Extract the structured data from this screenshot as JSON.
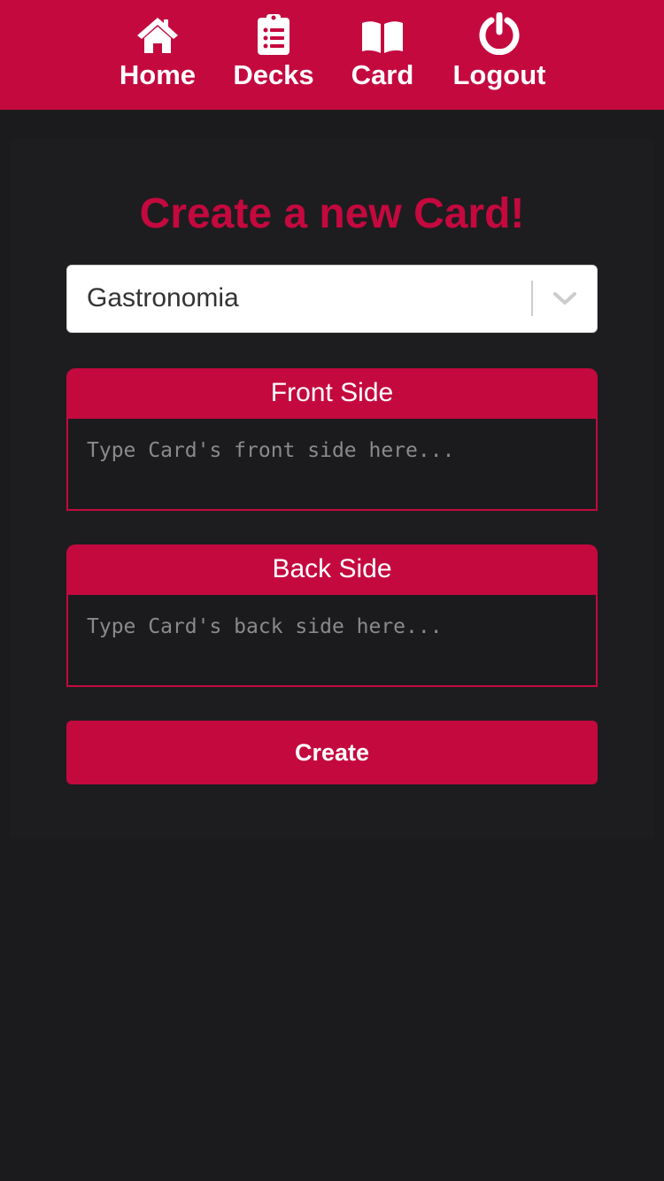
{
  "nav": {
    "items": [
      {
        "label": "Home",
        "icon": "home-icon"
      },
      {
        "label": "Decks",
        "icon": "clipboard-list-icon"
      },
      {
        "label": "Card",
        "icon": "book-open-icon"
      },
      {
        "label": "Logout",
        "icon": "power-icon"
      }
    ]
  },
  "form": {
    "title": "Create a new Card!",
    "deck_select": {
      "value": "Gastronomia",
      "icon": "chevron-down-icon"
    },
    "front": {
      "header": "Front Side",
      "placeholder": "Type Card's front side here...",
      "value": ""
    },
    "back": {
      "header": "Back Side",
      "placeholder": "Type Card's back side here...",
      "value": ""
    },
    "submit_label": "Create"
  },
  "colors": {
    "accent": "#c4093f",
    "background": "#1b1b1d",
    "text_light": "#ffffff",
    "placeholder": "#8a8a8a"
  }
}
